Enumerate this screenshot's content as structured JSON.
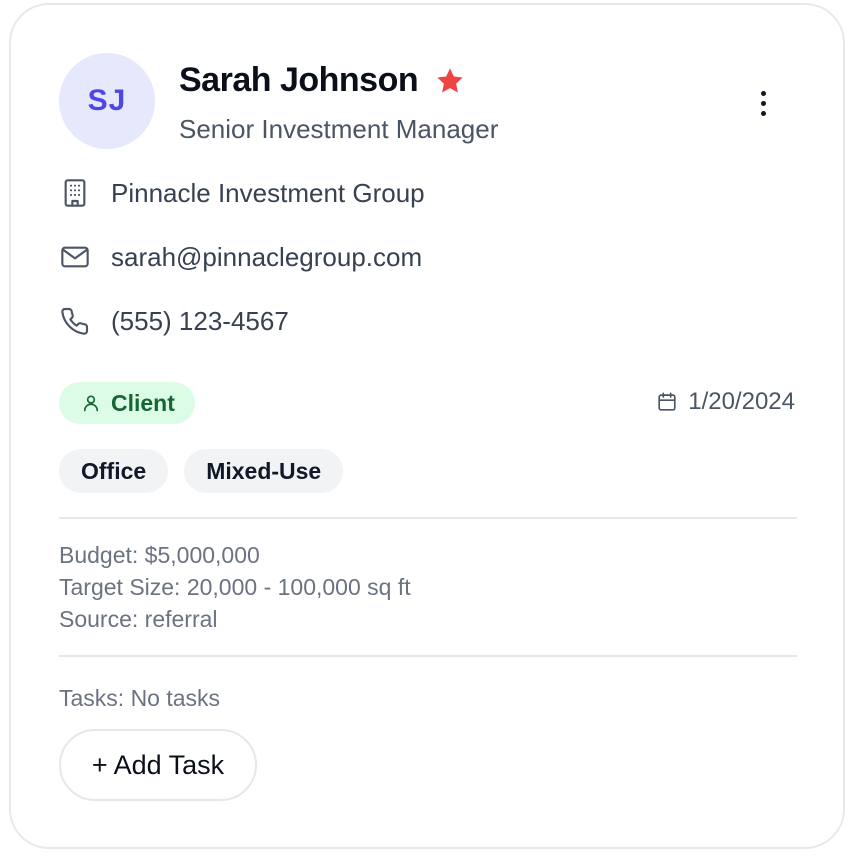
{
  "contact": {
    "initials": "SJ",
    "name": "Sarah Johnson",
    "job_title": "Senior Investment Manager",
    "company": "Pinnacle Investment Group",
    "email": "sarah@pinnaclegroup.com",
    "phone": "(555) 123-4567",
    "favorite": true
  },
  "status": {
    "label": "Client",
    "date": "1/20/2024"
  },
  "tags": [
    "Office",
    "Mixed-Use"
  ],
  "details": {
    "budget": "Budget: $5,000,000",
    "target_size": "Target Size: 20,000 - 100,000 sq ft",
    "source": "Source: referral"
  },
  "tasks": {
    "summary": "Tasks: No tasks",
    "add_label": "+ Add Task"
  },
  "icons": {
    "favorite": "star-icon",
    "menu": "more-vertical-icon",
    "company": "building-icon",
    "email": "mail-icon",
    "phone": "phone-icon",
    "status": "user-icon",
    "date": "calendar-icon"
  },
  "colors": {
    "accent": "#4f46e5",
    "avatar_bg": "#e5e9fb",
    "star": "#ef4444",
    "client_bg": "#dcfce7",
    "client_text": "#166534",
    "tag_bg": "#f1f3f5"
  }
}
